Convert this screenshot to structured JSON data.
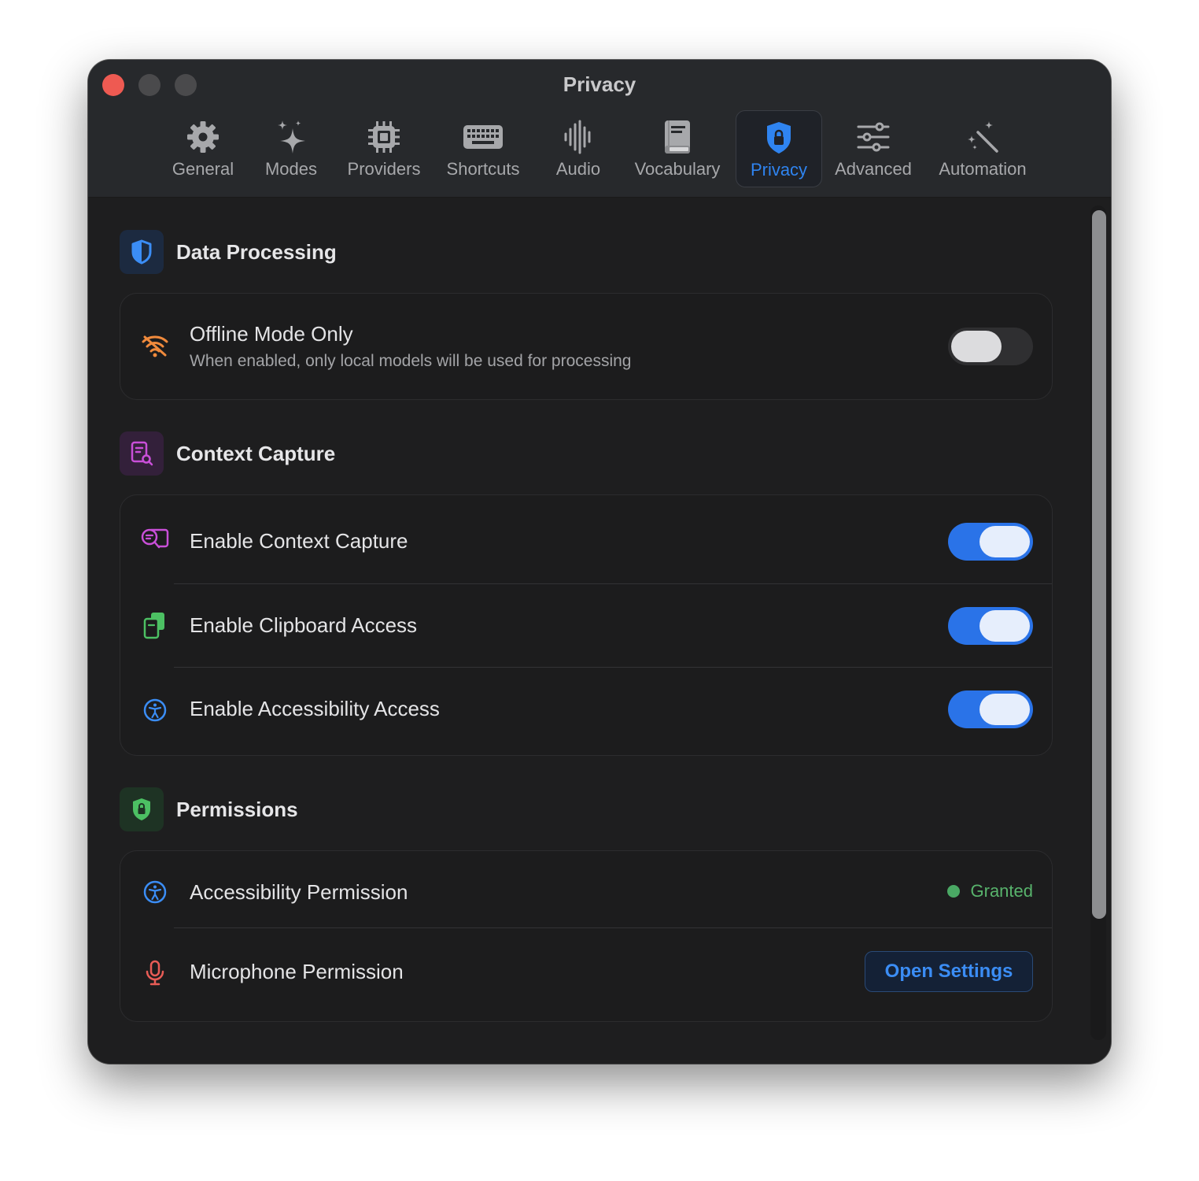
{
  "window": {
    "title": "Privacy"
  },
  "tabs": [
    {
      "label": "General",
      "icon": "gear-icon"
    },
    {
      "label": "Modes",
      "icon": "sparkles-icon"
    },
    {
      "label": "Providers",
      "icon": "cpu-icon"
    },
    {
      "label": "Shortcuts",
      "icon": "keyboard-icon"
    },
    {
      "label": "Audio",
      "icon": "waveform-icon"
    },
    {
      "label": "Vocabulary",
      "icon": "book-icon"
    },
    {
      "label": "Privacy",
      "icon": "lock-shield-icon",
      "active": true
    },
    {
      "label": "Advanced",
      "icon": "sliders-icon"
    },
    {
      "label": "Automation",
      "icon": "magic-wand-icon"
    }
  ],
  "sections": {
    "data_processing": {
      "title": "Data Processing",
      "icon": "shield-half-icon",
      "offline": {
        "label": "Offline Mode Only",
        "description": "When enabled, only local models will be used for processing",
        "enabled": false,
        "icon": "wifi-slash-icon"
      }
    },
    "context_capture": {
      "title": "Context Capture",
      "icon": "document-search-icon",
      "items": [
        {
          "label": "Enable Context Capture",
          "enabled": true,
          "icon": "text-magnify-icon"
        },
        {
          "label": "Enable Clipboard Access",
          "enabled": true,
          "icon": "clipboard-icon"
        },
        {
          "label": "Enable Accessibility Access",
          "enabled": true,
          "icon": "accessibility-icon"
        }
      ]
    },
    "permissions": {
      "title": "Permissions",
      "icon": "lock-shield-icon",
      "accessibility": {
        "label": "Accessibility Permission",
        "status": "Granted",
        "icon": "accessibility-icon"
      },
      "microphone": {
        "label": "Microphone Permission",
        "button": "Open Settings",
        "icon": "microphone-icon"
      }
    }
  },
  "colors": {
    "accent": "#2a73e8",
    "granted": "#58b36c",
    "offline_icon": "#f08a3c",
    "context_icon": "#c94fd8",
    "clipboard_icon": "#4cc063",
    "microphone_icon": "#e85c56"
  }
}
